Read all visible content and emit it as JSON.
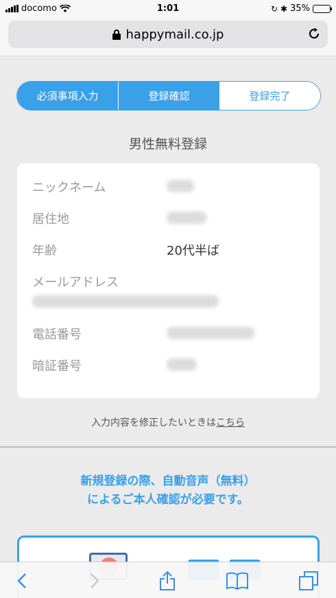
{
  "statusbar": {
    "carrier": "docomo",
    "time": "1:01",
    "battery": "35%",
    "battery_level": 0.35
  },
  "browser": {
    "url": "happymail.co.jp"
  },
  "steps": [
    {
      "label": "必須事項入力",
      "state": "done"
    },
    {
      "label": "登録確認",
      "state": "done"
    },
    {
      "label": "登録完了",
      "state": "current"
    }
  ],
  "page": {
    "title": "男性無料登録"
  },
  "profile": {
    "nickname_label": "ニックネーム",
    "residence_label": "居住地",
    "age_label": "年齢",
    "age_value": "20代半ば",
    "email_label": "メールアドレス",
    "phone_label": "電話番号",
    "pin_label": "暗証番号"
  },
  "edit_note": {
    "text": "入力内容を修正したいときは",
    "link": "こちら"
  },
  "notice": {
    "line1": "新規登録の際、自動音声（無料）",
    "line2": "によるご本人確認が必要です。"
  },
  "colors": {
    "accent": "#3aa0e8",
    "background": "#ebebeb"
  },
  "toolbar": {
    "icons": [
      "back-icon",
      "forward-icon",
      "share-icon",
      "bookmarks-icon",
      "tabs-icon"
    ]
  }
}
